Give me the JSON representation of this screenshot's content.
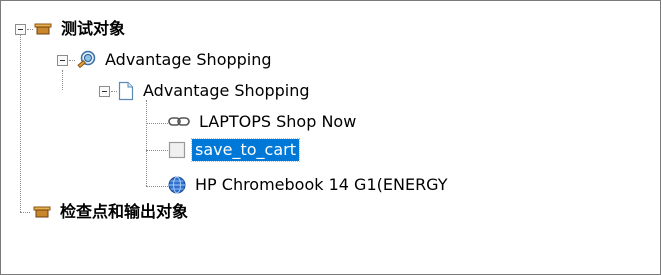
{
  "tree": {
    "root": {
      "label": "测试对象",
      "icon": "folder-tray-icon",
      "expanded": true
    },
    "test_object": {
      "label": "Advantage Shopping",
      "icon": "browser-icon",
      "expanded": true
    },
    "page": {
      "label": "Advantage Shopping",
      "icon": "page-icon",
      "expanded": true
    },
    "children": [
      {
        "label": "LAPTOPS Shop Now",
        "icon": "link-icon"
      },
      {
        "label": "save_to_cart",
        "icon": "checkbox-object-icon",
        "selected": true
      },
      {
        "label": "HP Chromebook 14 G1(ENERGY",
        "icon": "globe-icon"
      }
    ],
    "checkpoints": {
      "label": "检查点和输出对象",
      "icon": "folder-tray-icon"
    }
  },
  "colors": {
    "selection": "#0078d7",
    "tray": "#c9862d",
    "border": "#7a7a7a"
  }
}
